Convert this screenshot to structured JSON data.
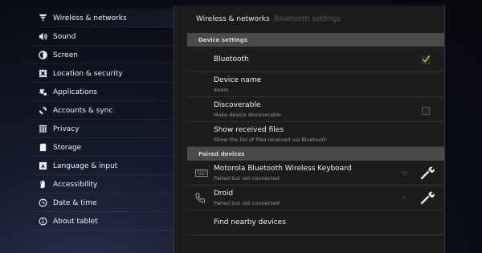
{
  "nav": {
    "items": [
      {
        "label": "Wireless & networks",
        "icon": "wireless-icon"
      },
      {
        "label": "Sound",
        "icon": "sound-icon"
      },
      {
        "label": "Screen",
        "icon": "screen-icon"
      },
      {
        "label": "Location & security",
        "icon": "location-security-icon"
      },
      {
        "label": "Applications",
        "icon": "applications-icon"
      },
      {
        "label": "Accounts & sync",
        "icon": "accounts-sync-icon"
      },
      {
        "label": "Privacy",
        "icon": "privacy-icon"
      },
      {
        "label": "Storage",
        "icon": "storage-icon"
      },
      {
        "label": "Language & input",
        "icon": "language-input-icon"
      },
      {
        "label": "Accessibility",
        "icon": "accessibility-icon"
      },
      {
        "label": "Date & time",
        "icon": "date-time-icon"
      },
      {
        "label": "About tablet",
        "icon": "about-tablet-icon"
      }
    ]
  },
  "breadcrumb": {
    "current": "Wireless & networks",
    "sub": "Bluetooth settings"
  },
  "sections": {
    "device": "Device settings",
    "paired": "Paired devices"
  },
  "device_settings": {
    "bluetooth": {
      "title": "Bluetooth",
      "checked": true
    },
    "device_name": {
      "title": "Device name",
      "summary": "Xoom"
    },
    "discoverable": {
      "title": "Discoverable",
      "summary": "Make device discoverable",
      "checked": false
    },
    "received": {
      "title": "Show received files",
      "summary": "Show the list of files received via Bluetooth"
    }
  },
  "paired": [
    {
      "name": "Motorola Bluetooth Wireless Keyboard",
      "status": "Paired but not connected",
      "icon": "keyboard-icon"
    },
    {
      "name": "Droid",
      "status": "Paired but not connected",
      "icon": "phone-icon"
    }
  ],
  "find_nearby": "Find nearby devices",
  "colors": {
    "accent": "#8fbf2e",
    "background": "#1c1c1c",
    "header": "#4a4a4a"
  }
}
